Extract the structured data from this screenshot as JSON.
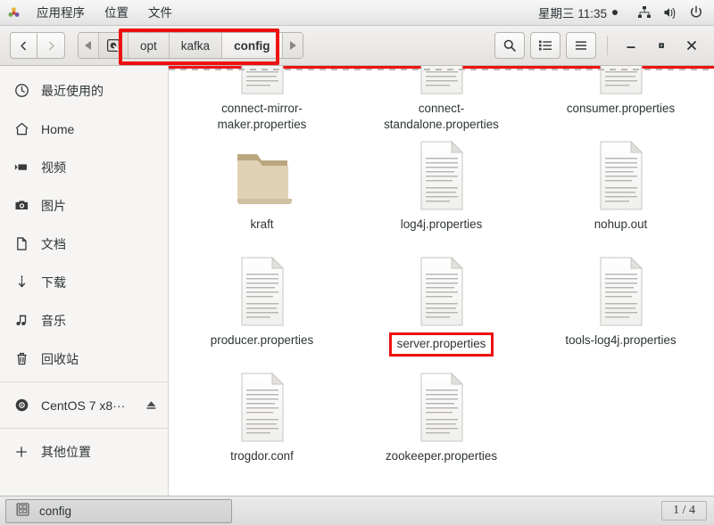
{
  "panel": {
    "logo_icon": "gnome-applications-icon",
    "menus": [
      {
        "label": "应用程序",
        "name": "applications-menu"
      },
      {
        "label": "位置",
        "name": "places-menu"
      },
      {
        "label": "文件",
        "name": "files-menu"
      }
    ],
    "clock": "星期三  11:35",
    "indicator_icons": [
      "network-icon",
      "volume-icon",
      "power-icon"
    ]
  },
  "headerbar": {
    "back_icon": "chevron-left-icon",
    "forward_icon": "chevron-right-icon",
    "path_prev_icon": "triangle-left-icon",
    "path_next_icon": "triangle-right-icon",
    "root_icon": "disk-icon",
    "breadcrumbs": [
      {
        "label": "opt",
        "current": false
      },
      {
        "label": "kafka",
        "current": false
      },
      {
        "label": "config",
        "current": true
      }
    ],
    "actions": [
      {
        "name": "search-button",
        "icon": "search-icon"
      },
      {
        "name": "view-list-button",
        "icon": "list-view-icon"
      },
      {
        "name": "main-menu-button",
        "icon": "hamburger-icon"
      }
    ],
    "window_controls": [
      {
        "name": "minimize-button",
        "icon": "minimize-icon"
      },
      {
        "name": "maximize-button",
        "icon": "maximize-icon"
      },
      {
        "name": "close-button",
        "icon": "close-icon"
      }
    ]
  },
  "sidebar": {
    "items": [
      {
        "label": "最近使用的",
        "icon": "clock-icon",
        "name": "sidebar-item-recent"
      },
      {
        "label": "Home",
        "icon": "home-icon",
        "name": "sidebar-item-home"
      },
      {
        "label": "视频",
        "icon": "video-icon",
        "name": "sidebar-item-videos"
      },
      {
        "label": "图片",
        "icon": "camera-icon",
        "name": "sidebar-item-pictures"
      },
      {
        "label": "文档",
        "icon": "document-icon",
        "name": "sidebar-item-documents"
      },
      {
        "label": "下载",
        "icon": "download-icon",
        "name": "sidebar-item-downloads"
      },
      {
        "label": "音乐",
        "icon": "music-icon",
        "name": "sidebar-item-music"
      },
      {
        "label": "回收站",
        "icon": "trash-icon",
        "name": "sidebar-item-trash"
      }
    ],
    "devices": [
      {
        "label": "CentOS 7 x8···",
        "icon": "disc-icon",
        "eject_icon": "eject-icon",
        "name": "sidebar-item-centos-disc"
      }
    ],
    "other": {
      "label": "其他位置",
      "icon": "plus-icon",
      "name": "sidebar-item-other-locations"
    }
  },
  "files": [
    {
      "name": "connect-mirror-maker.properties",
      "type": "file",
      "highlighted": false
    },
    {
      "name": "connect-standalone.properties",
      "type": "file",
      "highlighted": false
    },
    {
      "name": "consumer.properties",
      "type": "file",
      "highlighted": false
    },
    {
      "name": "kraft",
      "type": "folder",
      "highlighted": false
    },
    {
      "name": "log4j.properties",
      "type": "file",
      "highlighted": false
    },
    {
      "name": "nohup.out",
      "type": "file",
      "highlighted": false
    },
    {
      "name": "producer.properties",
      "type": "file",
      "highlighted": false
    },
    {
      "name": "server.properties",
      "type": "file",
      "highlighted": true
    },
    {
      "name": "tools-log4j.properties",
      "type": "file",
      "highlighted": false
    },
    {
      "name": "trogdor.conf",
      "type": "file",
      "highlighted": false
    },
    {
      "name": "zookeeper.properties",
      "type": "file",
      "highlighted": false
    }
  ],
  "taskbar": {
    "window_title": "config",
    "window_icon": "file-manager-icon",
    "workspace": "1 / 4"
  },
  "annotations": {
    "accent_color": "#ee1111"
  }
}
